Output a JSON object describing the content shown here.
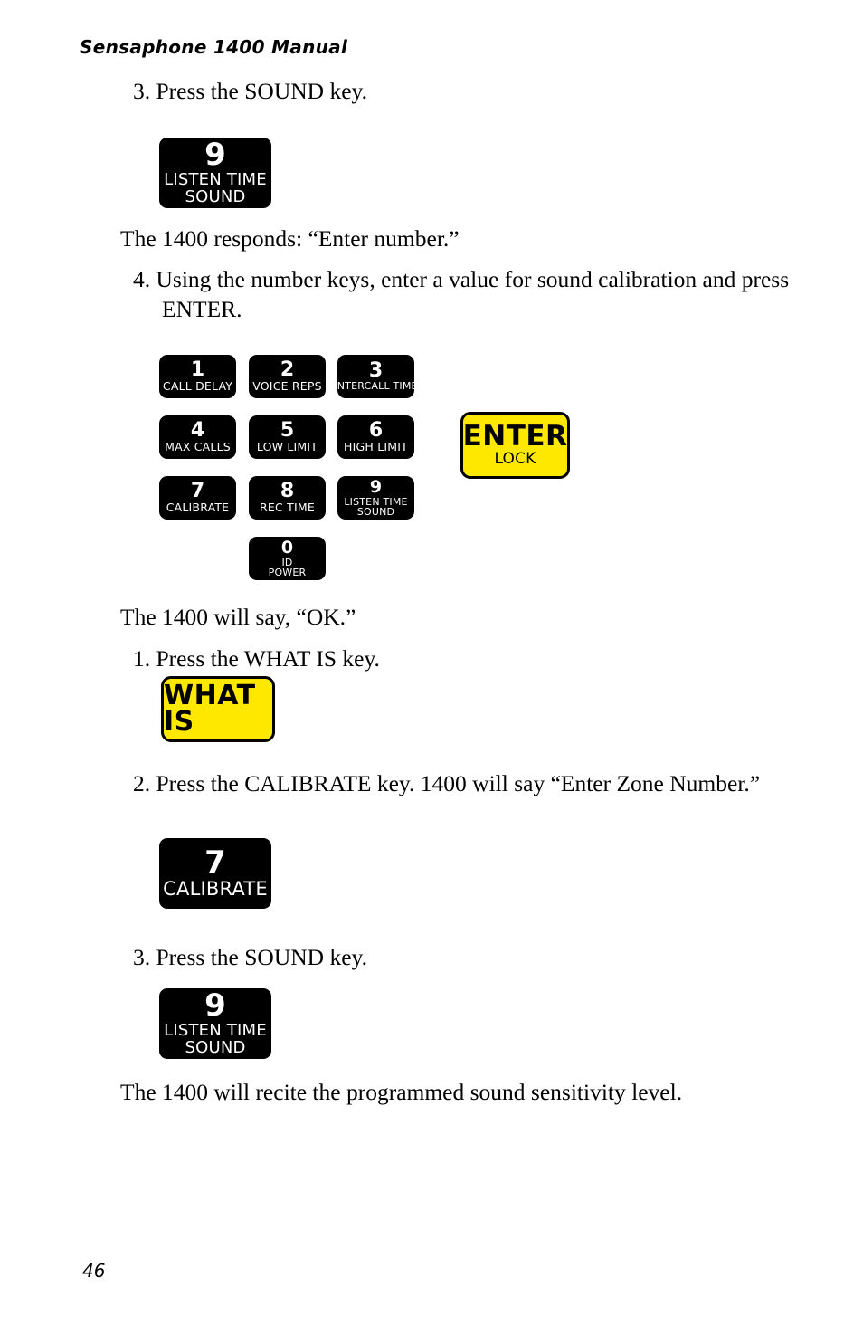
{
  "page": {
    "header": "Sensaphone 1400 Manual",
    "number": "46"
  },
  "steps": {
    "step3_sound_top": "3. Press the SOUND key.",
    "responds_enter_number": "The 1400 responds: “Enter number.”",
    "step4_enter_value": "4. Using the number keys, enter a value for sound calibration and press ENTER.",
    "will_say_ok": "The 1400 will say, “OK.”",
    "step1_what_is": "1. Press the WHAT IS key.",
    "step2_calibrate": "2. Press the CALIBRATE key. 1400 will say “Enter Zone Number.”",
    "step3_sound_bottom": "3. Press the SOUND key.",
    "recite_level": "The 1400 will recite the programmed sound sensitivity level."
  },
  "keys": {
    "sound_top": {
      "digit": "9",
      "line1": "LISTEN TIME",
      "line2": "SOUND",
      "color": "#000000",
      "text_color": "#ffffff"
    },
    "keypad": [
      {
        "digit": "1",
        "line1": "CALL DELAY",
        "line2": ""
      },
      {
        "digit": "2",
        "line1": "VOICE REPS",
        "line2": ""
      },
      {
        "digit": "3",
        "line1": "INTERCALL TIME",
        "line2": ""
      },
      {
        "digit": "4",
        "line1": "MAX CALLS",
        "line2": ""
      },
      {
        "digit": "5",
        "line1": "LOW LIMIT",
        "line2": ""
      },
      {
        "digit": "6",
        "line1": "HIGH LIMIT",
        "line2": ""
      },
      {
        "digit": "7",
        "line1": "CALIBRATE",
        "line2": ""
      },
      {
        "digit": "8",
        "line1": "REC TIME",
        "line2": ""
      },
      {
        "digit": "9",
        "line1": "LISTEN TIME",
        "line2": "SOUND"
      }
    ],
    "zero": {
      "digit": "0",
      "line1": "ID",
      "line2": "POWER"
    },
    "enter": {
      "label": "ENTER",
      "sublabel": "LOCK",
      "color": "#ffe800",
      "text_color": "#000000"
    },
    "what_is": {
      "label": "WHAT IS",
      "color": "#ffe800",
      "text_color": "#000000"
    },
    "calibrate": {
      "digit": "7",
      "line1": "CALIBRATE",
      "line2": "",
      "color": "#000000",
      "text_color": "#ffffff"
    },
    "sound_bottom": {
      "digit": "9",
      "line1": "LISTEN TIME",
      "line2": "SOUND",
      "color": "#000000",
      "text_color": "#ffffff"
    }
  }
}
